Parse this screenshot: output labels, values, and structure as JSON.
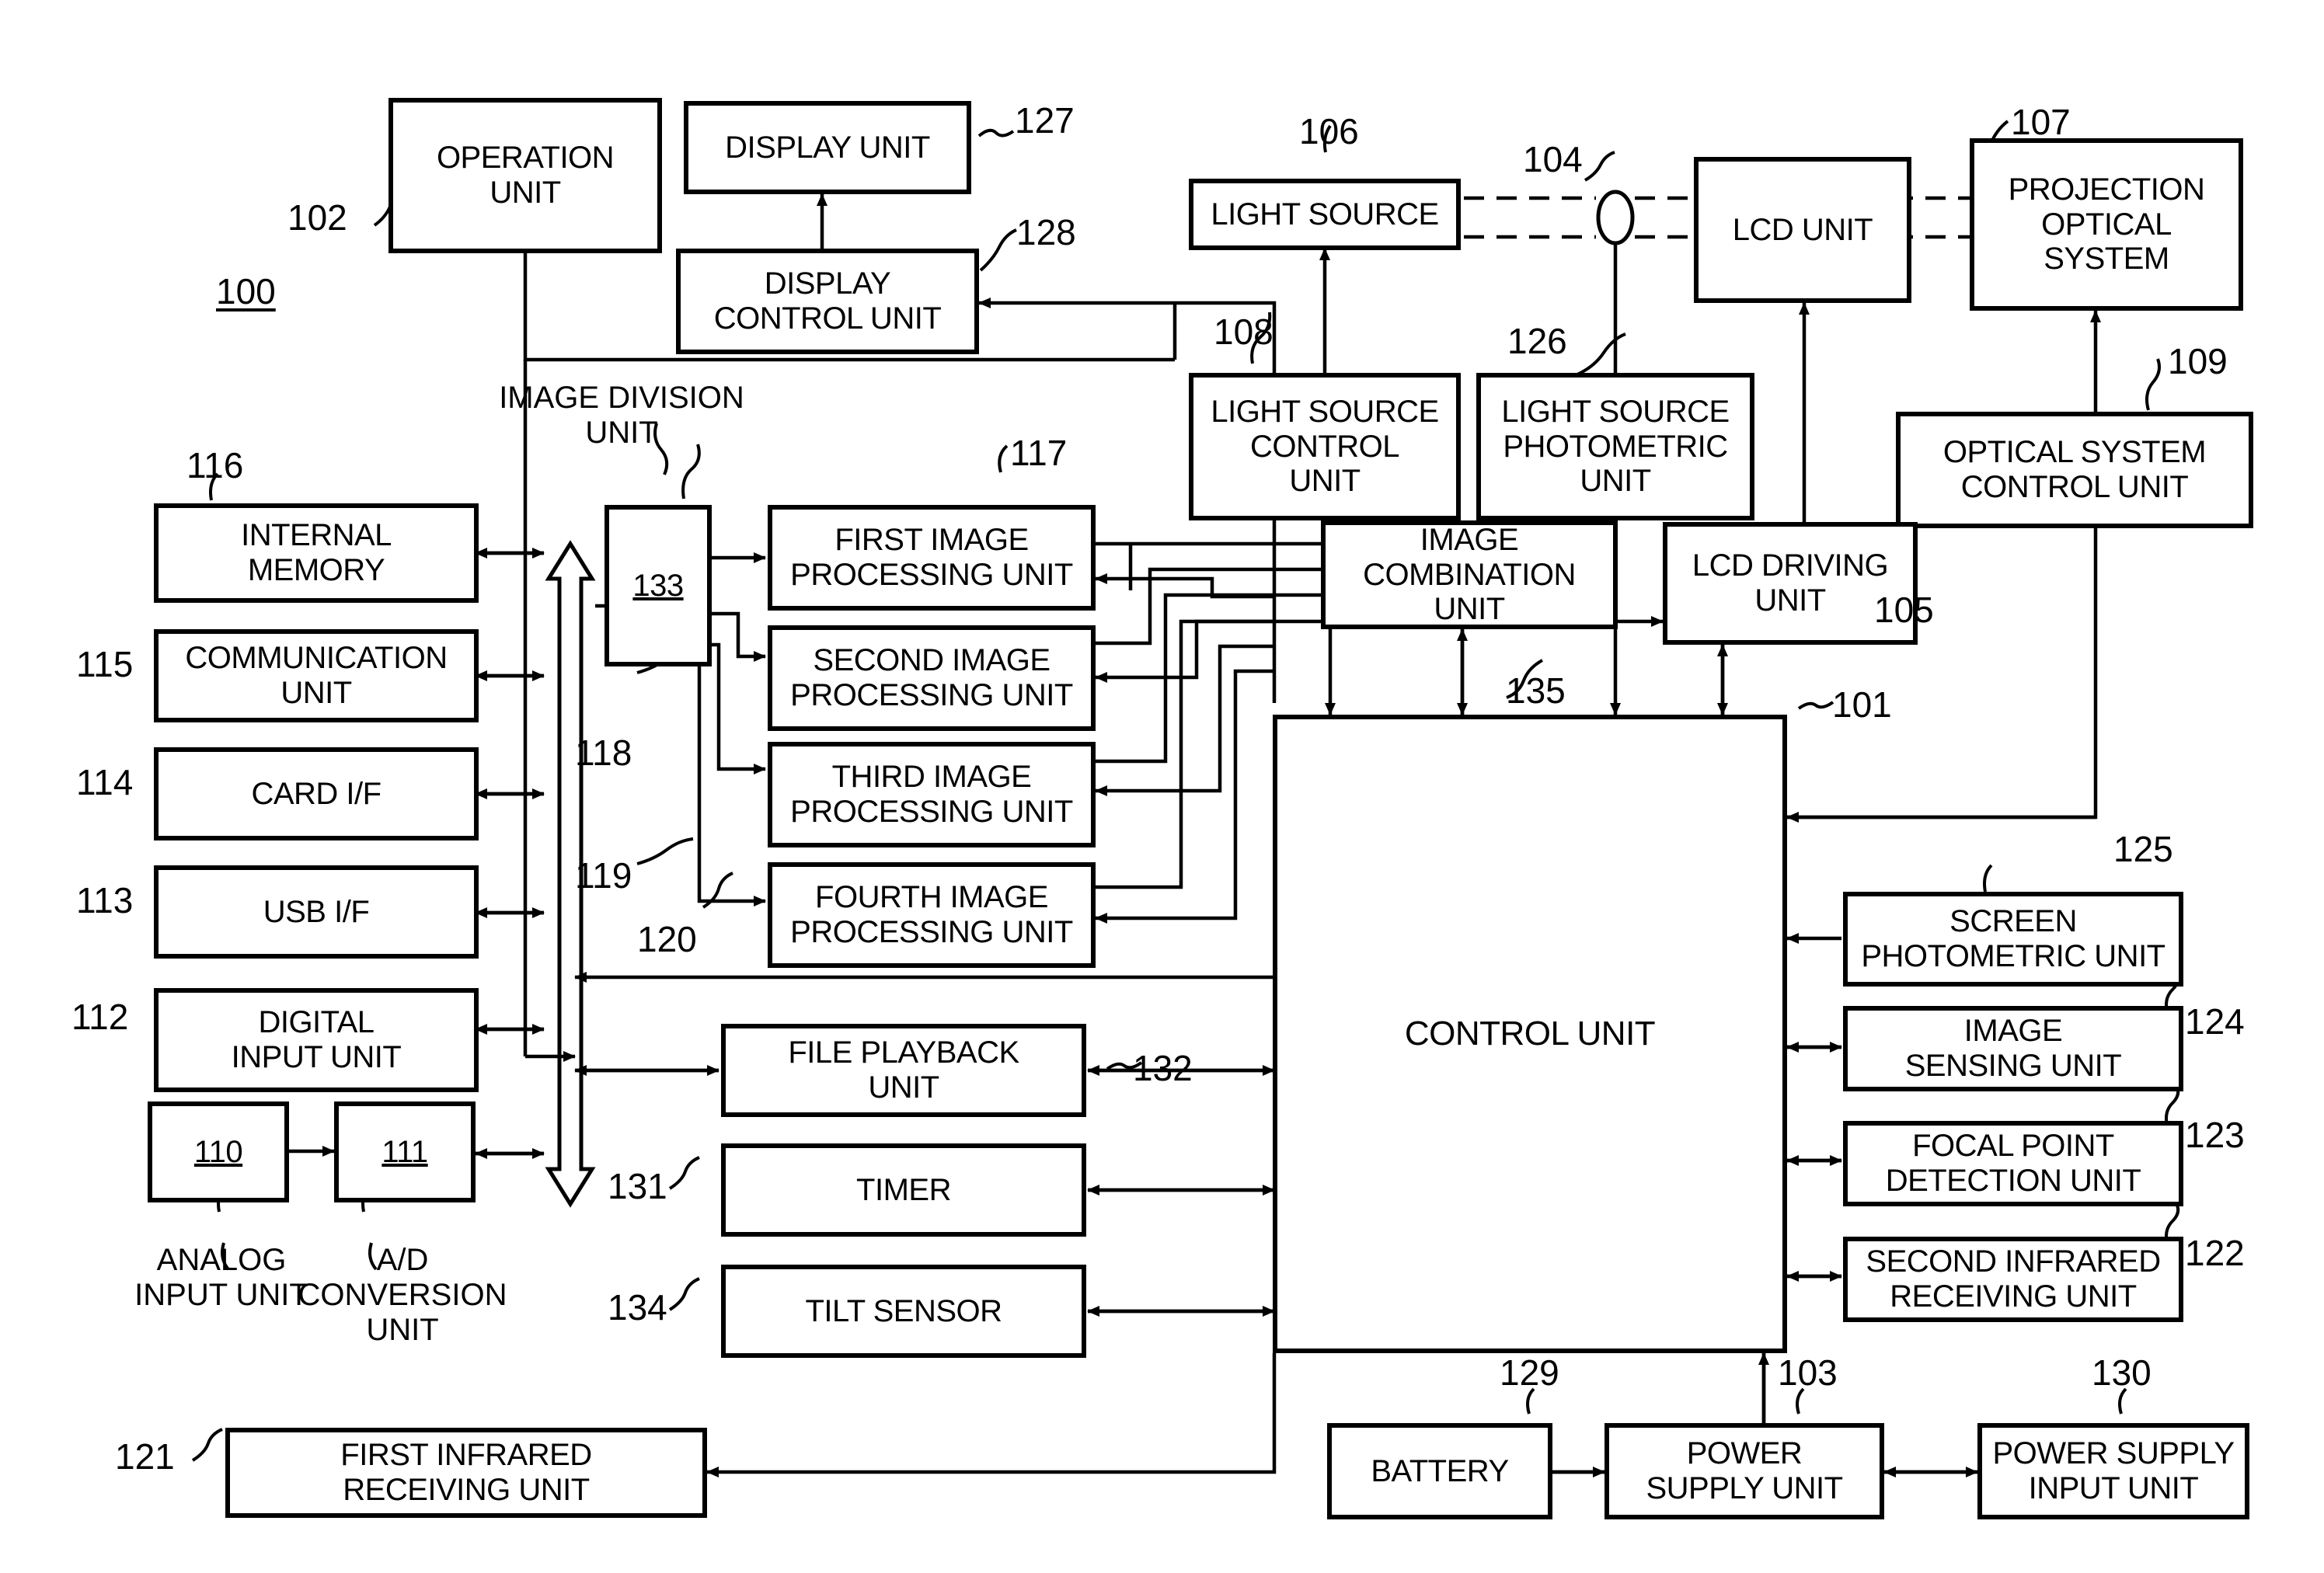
{
  "figure": {
    "system_label": "100",
    "title_free_labels": [
      {
        "name": "image-division-unit-caption",
        "text": "IMAGE DIVISION\nUNIT"
      },
      {
        "name": "analog-input-unit-caption",
        "text": "ANALOG\nINPUT UNIT"
      },
      {
        "name": "ad-conversion-unit-caption",
        "text": "A/D\nCONVERSION\nUNIT"
      }
    ]
  },
  "blocks": [
    {
      "id": "operation-unit",
      "label": "OPERATION\nUNIT",
      "ref": "102"
    },
    {
      "id": "display-unit",
      "label": "DISPLAY UNIT",
      "ref": "127"
    },
    {
      "id": "display-control-unit",
      "label": "DISPLAY\nCONTROL UNIT",
      "ref": "128"
    },
    {
      "id": "light-source",
      "label": "LIGHT SOURCE",
      "ref": "106"
    },
    {
      "id": "lcd-unit",
      "label": "LCD UNIT",
      "ref": "104"
    },
    {
      "id": "projection-optical-system",
      "label": "PROJECTION\nOPTICAL\nSYSTEM",
      "ref": "107"
    },
    {
      "id": "light-source-control-unit",
      "label": "LIGHT SOURCE\nCONTROL\nUNIT",
      "ref": "108"
    },
    {
      "id": "light-source-photometric-unit",
      "label": "LIGHT SOURCE\nPHOTOMETRIC\nUNIT",
      "ref": "126"
    },
    {
      "id": "optical-system-control-unit",
      "label": "OPTICAL SYSTEM\nCONTROL UNIT",
      "ref": "109"
    },
    {
      "id": "internal-memory",
      "label": "INTERNAL\nMEMORY",
      "ref": "116"
    },
    {
      "id": "communication-unit",
      "label": "COMMUNICATION\nUNIT",
      "ref": "115"
    },
    {
      "id": "card-if",
      "label": "CARD I/F",
      "ref": "114"
    },
    {
      "id": "usb-if",
      "label": "USB I/F",
      "ref": "113"
    },
    {
      "id": "digital-input-unit",
      "label": "DIGITAL\nINPUT UNIT",
      "ref": "112"
    },
    {
      "id": "analog-input-unit",
      "label": "110",
      "ref": "110"
    },
    {
      "id": "ad-conversion-unit",
      "label": "111",
      "ref": "111"
    },
    {
      "id": "image-division-unit",
      "label": "133",
      "ref": "133"
    },
    {
      "id": "first-image-processing-unit",
      "label": "FIRST IMAGE\nPROCESSING UNIT",
      "ref": "117"
    },
    {
      "id": "second-image-processing-unit",
      "label": "SECOND IMAGE\nPROCESSING UNIT",
      "ref": "118"
    },
    {
      "id": "third-image-processing-unit",
      "label": "THIRD IMAGE\nPROCESSING UNIT",
      "ref": "119"
    },
    {
      "id": "fourth-image-processing-unit",
      "label": "FOURTH IMAGE\nPROCESSING UNIT",
      "ref": "120"
    },
    {
      "id": "image-combination-unit",
      "label": "IMAGE\nCOMBINATION\nUNIT",
      "ref": "135"
    },
    {
      "id": "lcd-driving-unit",
      "label": "LCD DRIVING\nUNIT",
      "ref": "105"
    },
    {
      "id": "control-unit",
      "label": "CONTROL UNIT",
      "ref": "101"
    },
    {
      "id": "screen-photometric-unit",
      "label": "SCREEN\nPHOTOMETRIC UNIT",
      "ref": "125"
    },
    {
      "id": "image-sensing-unit",
      "label": "IMAGE\nSENSING UNIT",
      "ref": "124"
    },
    {
      "id": "focal-point-detection-unit",
      "label": "FOCAL POINT\nDETECTION UNIT",
      "ref": "123"
    },
    {
      "id": "second-infrared-receiving-unit",
      "label": "SECOND INFRARED\nRECEIVING UNIT",
      "ref": "122"
    },
    {
      "id": "first-infrared-receiving-unit",
      "label": "FIRST INFRARED\nRECEIVING UNIT",
      "ref": "121"
    },
    {
      "id": "file-playback-unit",
      "label": "FILE PLAYBACK\nUNIT",
      "ref": "132"
    },
    {
      "id": "timer",
      "label": "TIMER",
      "ref": "131"
    },
    {
      "id": "tilt-sensor",
      "label": "TILT SENSOR",
      "ref": "134"
    },
    {
      "id": "battery",
      "label": "BATTERY",
      "ref": "129"
    },
    {
      "id": "power-supply-unit",
      "label": "POWER\nSUPPLY UNIT",
      "ref": "103"
    },
    {
      "id": "power-supply-input-unit",
      "label": "POWER SUPPLY\nINPUT UNIT",
      "ref": "130"
    }
  ],
  "reference_numerals": {
    "n100": "100",
    "n101": "101",
    "n102": "102",
    "n103": "103",
    "n104": "104",
    "n105": "105",
    "n106": "106",
    "n107": "107",
    "n108": "108",
    "n109": "109",
    "n110": "110",
    "n111": "111",
    "n112": "112",
    "n113": "113",
    "n114": "114",
    "n115": "115",
    "n116": "116",
    "n117": "117",
    "n118": "118",
    "n119": "119",
    "n120": "120",
    "n121": "121",
    "n122": "122",
    "n123": "123",
    "n124": "124",
    "n125": "125",
    "n126": "126",
    "n127": "127",
    "n128": "128",
    "n129": "129",
    "n130": "130",
    "n131": "131",
    "n132": "132",
    "n133": "133",
    "n134": "134",
    "n135": "135"
  },
  "labels": {
    "operation_unit": "OPERATION\nUNIT",
    "display_unit": "DISPLAY UNIT",
    "display_control_unit": "DISPLAY\nCONTROL UNIT",
    "light_source": "LIGHT SOURCE",
    "lcd_unit": "LCD UNIT",
    "projection_optical_system": "PROJECTION\nOPTICAL\nSYSTEM",
    "light_source_control_unit": "LIGHT SOURCE\nCONTROL\nUNIT",
    "light_source_photometric_unit": "LIGHT SOURCE\nPHOTOMETRIC\nUNIT",
    "optical_system_control_unit": "OPTICAL SYSTEM\nCONTROL UNIT",
    "internal_memory": "INTERNAL\nMEMORY",
    "communication_unit": "COMMUNICATION\nUNIT",
    "card_if": "CARD I/F",
    "usb_if": "USB I/F",
    "digital_input_unit": "DIGITAL\nINPUT UNIT",
    "analog_input_box": "110",
    "ad_conversion_box": "111",
    "image_division_box": "133",
    "first_image_processing_unit": "FIRST IMAGE\nPROCESSING UNIT",
    "second_image_processing_unit": "SECOND IMAGE\nPROCESSING UNIT",
    "third_image_processing_unit": "THIRD IMAGE\nPROCESSING UNIT",
    "fourth_image_processing_unit": "FOURTH IMAGE\nPROCESSING UNIT",
    "image_combination_unit": "IMAGE\nCOMBINATION\nUNIT",
    "lcd_driving_unit": "LCD DRIVING\nUNIT",
    "control_unit": "CONTROL UNIT",
    "screen_photometric_unit": "SCREEN\nPHOTOMETRIC UNIT",
    "image_sensing_unit": "IMAGE\nSENSING UNIT",
    "focal_point_detection_unit": "FOCAL POINT\nDETECTION UNIT",
    "second_infrared_receiving_unit": "SECOND INFRARED\nRECEIVING UNIT",
    "first_infrared_receiving_unit": "FIRST INFRARED\nRECEIVING UNIT",
    "file_playback_unit": "FILE PLAYBACK\nUNIT",
    "timer": "TIMER",
    "tilt_sensor": "TILT SENSOR",
    "battery": "BATTERY",
    "power_supply_unit": "POWER\nSUPPLY UNIT",
    "power_supply_input_unit": "POWER SUPPLY\nINPUT UNIT",
    "image_division_caption": "IMAGE DIVISION\nUNIT",
    "analog_input_caption": "ANALOG\nINPUT UNIT",
    "ad_conversion_caption": "A/D\nCONVERSION\nUNIT"
  },
  "colors": {
    "line": "#000000",
    "background": "#ffffff",
    "text": "#000000"
  }
}
